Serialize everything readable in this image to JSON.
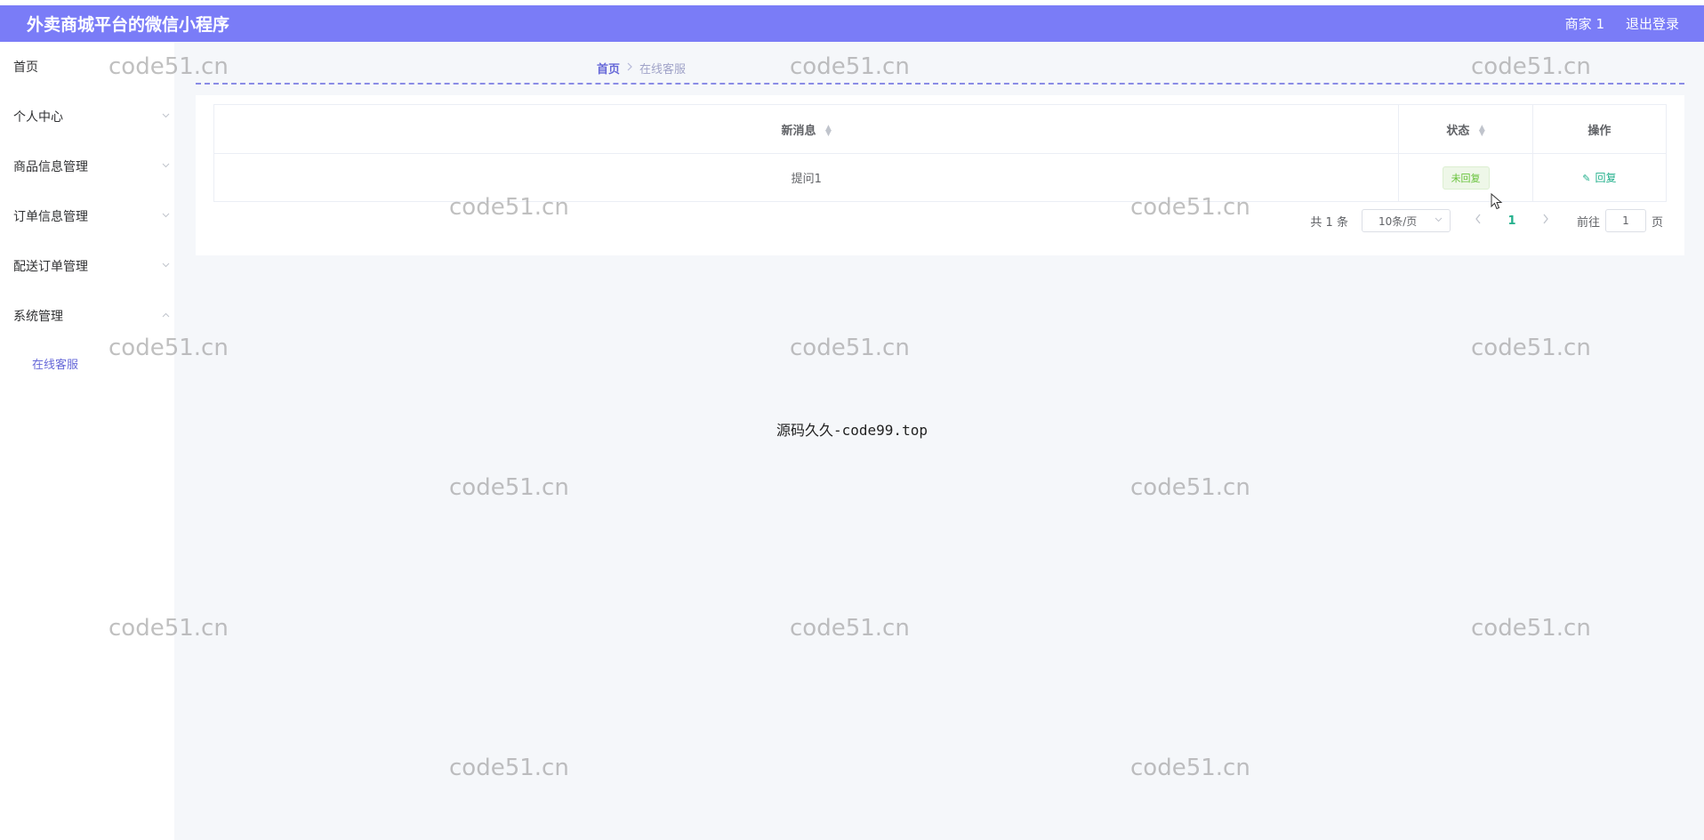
{
  "header": {
    "title": "外卖商城平台的微信小程序",
    "user": "商家 1",
    "logout": "退出登录",
    "color": "#7a7cf7"
  },
  "sidebar": {
    "items": [
      {
        "label": "首页",
        "has_arrow": false
      },
      {
        "label": "个人中心",
        "has_arrow": true
      },
      {
        "label": "商品信息管理",
        "has_arrow": true
      },
      {
        "label": "订单信息管理",
        "has_arrow": true
      },
      {
        "label": "配送订单管理",
        "has_arrow": true
      },
      {
        "label": "系统管理",
        "has_arrow": true,
        "expanded": true
      }
    ],
    "submenu": [
      {
        "label": "在线客服"
      }
    ]
  },
  "breadcrumb": {
    "home": "首页",
    "current": "在线客服"
  },
  "table": {
    "headers": [
      {
        "label": "新消息",
        "sortable": true
      },
      {
        "label": "状态",
        "sortable": true
      },
      {
        "label": "操作",
        "sortable": false
      }
    ],
    "rows": [
      {
        "message": "提问1",
        "status": "未回复",
        "action": "回复"
      }
    ]
  },
  "pagination": {
    "total": "共 1 条",
    "page_size": "10条/页",
    "current_page": "1",
    "goto_prefix": "前往",
    "goto_value": "1",
    "goto_suffix": "页"
  },
  "watermark": "code51.cn",
  "center_text": "源码久久-code99.top"
}
